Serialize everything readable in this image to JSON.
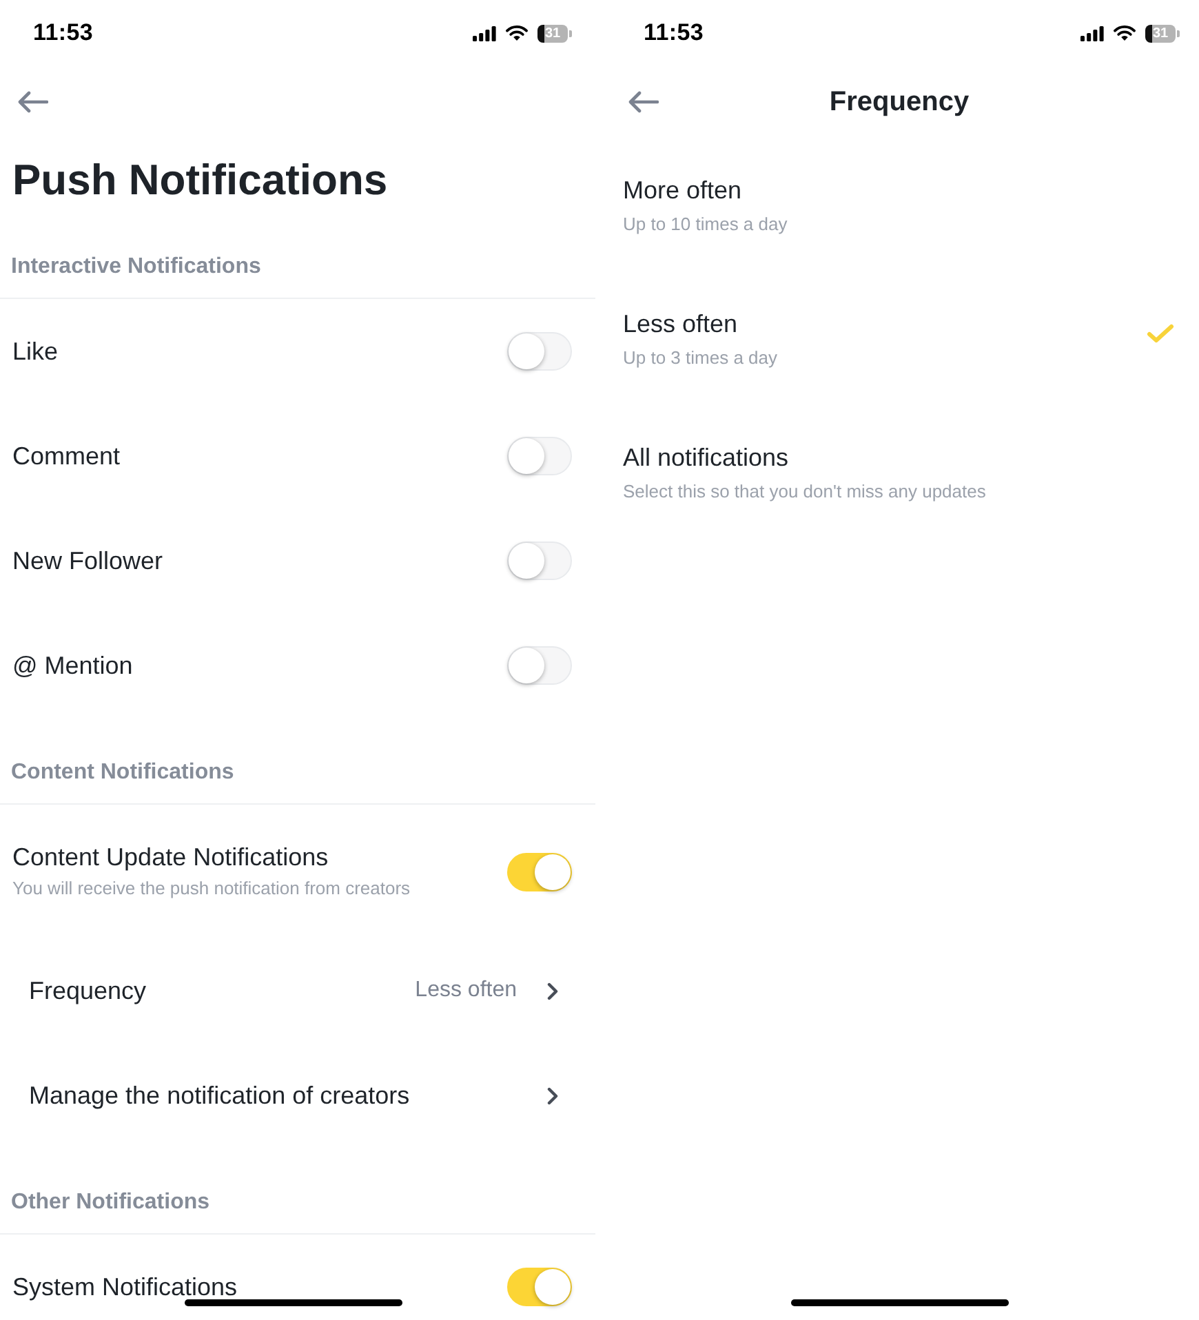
{
  "push_notifications_screen": {
    "status_bar": {
      "time": "11:53",
      "battery": "31"
    },
    "title": "Push Notifications",
    "sections": [
      {
        "heading": "Interactive Notifications",
        "items": [
          {
            "kind": "toggle",
            "label": "Like",
            "on": false
          },
          {
            "kind": "toggle",
            "label": "Comment",
            "on": false
          },
          {
            "kind": "toggle",
            "label": "New Follower",
            "on": false
          },
          {
            "kind": "toggle",
            "label": "@ Mention",
            "on": false
          }
        ]
      },
      {
        "heading": "Content Notifications",
        "items": [
          {
            "kind": "toggle",
            "label": "Content Update Notifications",
            "description": "You will receive the push notification from creators",
            "on": true
          },
          {
            "kind": "link",
            "label": "Frequency",
            "value": "Less often"
          },
          {
            "kind": "link",
            "label": "Manage the notification of creators"
          }
        ]
      },
      {
        "heading": "Other Notifications",
        "items": [
          {
            "kind": "toggle",
            "label": "System Notifications",
            "on": true
          }
        ]
      }
    ]
  },
  "frequency_screen": {
    "status_bar": {
      "time": "11:53",
      "battery": "31"
    },
    "title": "Frequency",
    "options": [
      {
        "label": "More often",
        "description": "Up to 10 times a day",
        "selected": false
      },
      {
        "label": "Less often",
        "description": "Up to 3 times a day",
        "selected": true
      },
      {
        "label": "All notifications",
        "description": "Select this so that you don't miss any updates",
        "selected": false
      }
    ]
  }
}
